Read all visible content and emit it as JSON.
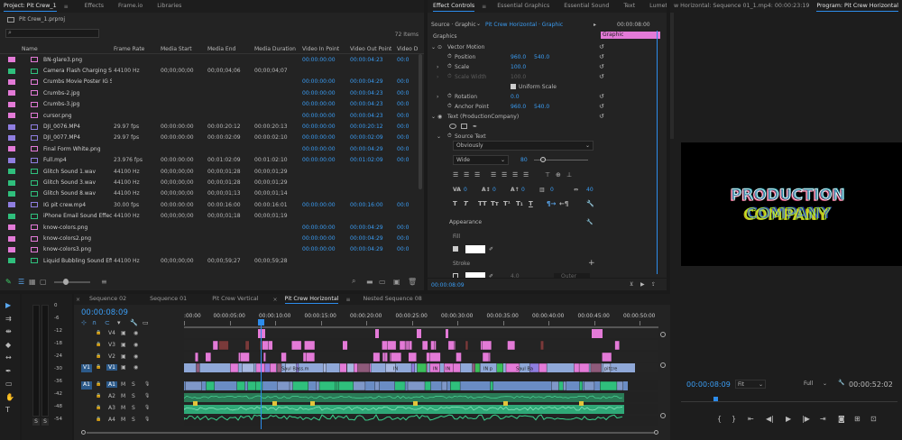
{
  "project": {
    "tabs": [
      "Project: Pit Crew_1",
      "Effects",
      "Frame.io",
      "Libraries"
    ],
    "file": "Pit Crew_1.prproj",
    "search_placeholder": "",
    "items_count": "72 Items",
    "columns": [
      "Name",
      "Frame Rate",
      "Media Start",
      "Media End",
      "Media Duration",
      "Video In Point",
      "Video Out Point",
      "Video D"
    ],
    "rows": [
      {
        "name": "BN-glare3.png",
        "fps": "",
        "start": "",
        "end": "",
        "dur": "",
        "in": "00:00:00:00",
        "out": "00:00:04:23",
        "d": "00:0",
        "color": "#e37ad7"
      },
      {
        "name": "Camera Flash Charging Soun",
        "fps": "44100 Hz",
        "start": "00;00;00;00",
        "end": "00;00;04;06",
        "dur": "00;00;04;07",
        "in": "",
        "out": "",
        "d": "",
        "color": "#2fbf7c"
      },
      {
        "name": "Crumbs Movie Poster IG Stor",
        "fps": "",
        "start": "",
        "end": "",
        "dur": "",
        "in": "00:00:00:00",
        "out": "00:00:04:29",
        "d": "00:0",
        "color": "#e37ad7"
      },
      {
        "name": "Crumbs-2.jpg",
        "fps": "",
        "start": "",
        "end": "",
        "dur": "",
        "in": "00:00:00:00",
        "out": "00:00:04:23",
        "d": "00:0",
        "color": "#e37ad7"
      },
      {
        "name": "Crumbs-3.jpg",
        "fps": "",
        "start": "",
        "end": "",
        "dur": "",
        "in": "00:00:00:00",
        "out": "00:00:04:23",
        "d": "00:0",
        "color": "#e37ad7"
      },
      {
        "name": "cursor.png",
        "fps": "",
        "start": "",
        "end": "",
        "dur": "",
        "in": "00:00:00:00",
        "out": "00:00:04:23",
        "d": "00:0",
        "color": "#e37ad7"
      },
      {
        "name": "DJI_0076.MP4",
        "fps": "29.97 fps",
        "start": "00:00:00:00",
        "end": "00:00:20:12",
        "dur": "00:00:20:13",
        "in": "00:00:00:00",
        "out": "00:00:20:12",
        "d": "00:0",
        "color": "#8f7ee0"
      },
      {
        "name": "DJI_0077.MP4",
        "fps": "29.97 fps",
        "start": "00:00:00:00",
        "end": "00:00:02:09",
        "dur": "00:00:02:10",
        "in": "00:00:00:00",
        "out": "00:00:02:09",
        "d": "00:0",
        "color": "#8f7ee0"
      },
      {
        "name": "Final Form White.png",
        "fps": "",
        "start": "",
        "end": "",
        "dur": "",
        "in": "00:00:00:00",
        "out": "00:00:04:29",
        "d": "00:0",
        "color": "#e37ad7"
      },
      {
        "name": "Full.mp4",
        "fps": "23.976 fps",
        "start": "00:00:00:00",
        "end": "00:01:02:09",
        "dur": "00:01:02:10",
        "in": "00:00:00:00",
        "out": "00:01:02:09",
        "d": "00:0",
        "color": "#8f7ee0"
      },
      {
        "name": "Glitch Sound 1.wav",
        "fps": "44100 Hz",
        "start": "00;00;00;00",
        "end": "00;00;01;28",
        "dur": "00;00;01;29",
        "in": "",
        "out": "",
        "d": "",
        "color": "#2fbf7c"
      },
      {
        "name": "Glitch Sound 3.wav",
        "fps": "44100 Hz",
        "start": "00;00;00;00",
        "end": "00;00;01;28",
        "dur": "00;00;01;29",
        "in": "",
        "out": "",
        "d": "",
        "color": "#2fbf7c"
      },
      {
        "name": "Glitch Sound 8.wav",
        "fps": "44100 Hz",
        "start": "00;00;00;00",
        "end": "00;00;01;13",
        "dur": "00;00;01;14",
        "in": "",
        "out": "",
        "d": "",
        "color": "#2fbf7c"
      },
      {
        "name": "IG pit crew.mp4",
        "fps": "30.00 fps",
        "start": "00:00:00:00",
        "end": "00:00:16:00",
        "dur": "00:00:16:01",
        "in": "00:00:00:00",
        "out": "00:00:16:00",
        "d": "00:0",
        "color": "#8f7ee0"
      },
      {
        "name": "iPhone Email Sound Effect.",
        "fps": "44100 Hz",
        "start": "00;00;00;00",
        "end": "00;00;01;18",
        "dur": "00;00;01;19",
        "in": "",
        "out": "",
        "d": "",
        "color": "#2fbf7c"
      },
      {
        "name": "know-colors.png",
        "fps": "",
        "start": "",
        "end": "",
        "dur": "",
        "in": "00:00:00:00",
        "out": "00:00:04:29",
        "d": "00:0",
        "color": "#e37ad7"
      },
      {
        "name": "know-colors2.png",
        "fps": "",
        "start": "",
        "end": "",
        "dur": "",
        "in": "00:00:00:00",
        "out": "00:00:04:29",
        "d": "00:0",
        "color": "#e37ad7"
      },
      {
        "name": "know-colors3.png",
        "fps": "",
        "start": "",
        "end": "",
        "dur": "",
        "in": "00:00:00:00",
        "out": "00:00:04:29",
        "d": "00:0",
        "color": "#e37ad7"
      },
      {
        "name": "Liquid Bubbling Sound Effec",
        "fps": "44100 Hz",
        "start": "00;00;00;00",
        "end": "00;00;59;27",
        "dur": "00;00;59;28",
        "in": "",
        "out": "",
        "d": "",
        "color": "#2fbf7c"
      }
    ]
  },
  "effects": {
    "tabs": [
      "Effect Controls",
      "Essential Graphics",
      "Essential Sound",
      "Text",
      "Lumetri C"
    ],
    "source": "Source · Graphic",
    "sequence": "Pit Crew Horizontal · Graphic",
    "timecode_top": "00:00:08:00",
    "graphic_bar": "Graphic",
    "section": "Graphics",
    "vector_motion": "Vector Motion",
    "position_label": "Position",
    "position_x": "960.0",
    "position_y": "540.0",
    "scale_label": "Scale",
    "scale_value": "100.0",
    "scale_width_label": "Scale Width",
    "scale_width_value": "100.0",
    "uniform_scale": "Uniform Scale",
    "rotation_label": "Rotation",
    "rotation_value": "0.0",
    "anchor_label": "Anchor Point",
    "anchor_x": "960.0",
    "anchor_y": "540.0",
    "text_layer": "Text (ProductionCompany)",
    "source_text": "Source Text",
    "font": "Obviously",
    "style": "Wide",
    "font_size": "80",
    "kerning": "0",
    "leading": "0",
    "baseline": "0",
    "tsume": "0",
    "tracking": "40",
    "appearance": "Appearance",
    "fill": "Fill",
    "stroke": "Stroke",
    "stroke_width": "4.0",
    "stroke_type": "Outer",
    "timecode_bottom": "00:00:08:09"
  },
  "program": {
    "source_tab": "w Horizontal: Sequence 01_1.mp4: 00:00:23:19",
    "tab": "Program: Pit Crew Horizontal",
    "title_line1": "PRODUCTION",
    "title_line2": "COMPANY",
    "timecode": "00:00:08:09",
    "fit": "Fit",
    "quality": "Full",
    "duration": "00:00:52:02"
  },
  "timeline": {
    "tabs": [
      "Sequence 02",
      "Sequence 01",
      "Pit Crew Vertical",
      "Pit Crew Horizontal",
      "Nested Sequence 08"
    ],
    "timecode": "00:00:08:09",
    "ruler": [
      ":00:00",
      "00:00:05:00",
      "00:00:10:00",
      "00:00:15:00",
      "00:00:20:00",
      "00:00:25:00",
      "00:00:30:00",
      "00:00:35:00",
      "00:00:40:00",
      "00:00:45:00",
      "00:00:50:00"
    ],
    "video_tracks": [
      "V4",
      "V3",
      "V2",
      "V1"
    ],
    "audio_tracks": [
      "A1",
      "A2",
      "A3",
      "A4"
    ],
    "source_patch_v": "V1",
    "source_patch_a": "A1",
    "clip_labels": [
      "Saul Bass.m",
      "Saul Ba",
      "IN",
      "IN",
      "IN",
      "IN p",
      "pitcre"
    ]
  },
  "meter": {
    "scale": [
      "0",
      "-6",
      "-12",
      "-18",
      "-24",
      "-30",
      "-36",
      "-42",
      "-48",
      "-54"
    ],
    "solo_left": "S",
    "solo_right": "S"
  },
  "colors": {
    "accent": "#2d8ceb",
    "graphic": "#e37ad7",
    "audio": "#2fbf7c",
    "video": "#8f7ee0"
  }
}
